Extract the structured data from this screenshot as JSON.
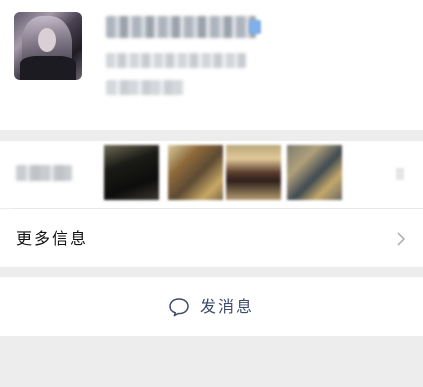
{
  "profile": {
    "avatar": "avatar-image",
    "name": "",
    "wechat_id": "",
    "region": ""
  },
  "moments": {
    "label": "",
    "thumbnails": [
      "moment-photo-1",
      "moment-photo-2",
      "moment-photo-3",
      "moment-photo-4"
    ]
  },
  "more_info": {
    "label": "更多信息",
    "icon": "chevron-right-icon"
  },
  "send_message": {
    "label": "发消息",
    "icon": "chat-bubble-icon"
  },
  "colors": {
    "page_background": "#ededed",
    "card_background": "#ffffff",
    "link_blue": "#3d4b6b",
    "chevron_gray": "#b2b2b2"
  }
}
